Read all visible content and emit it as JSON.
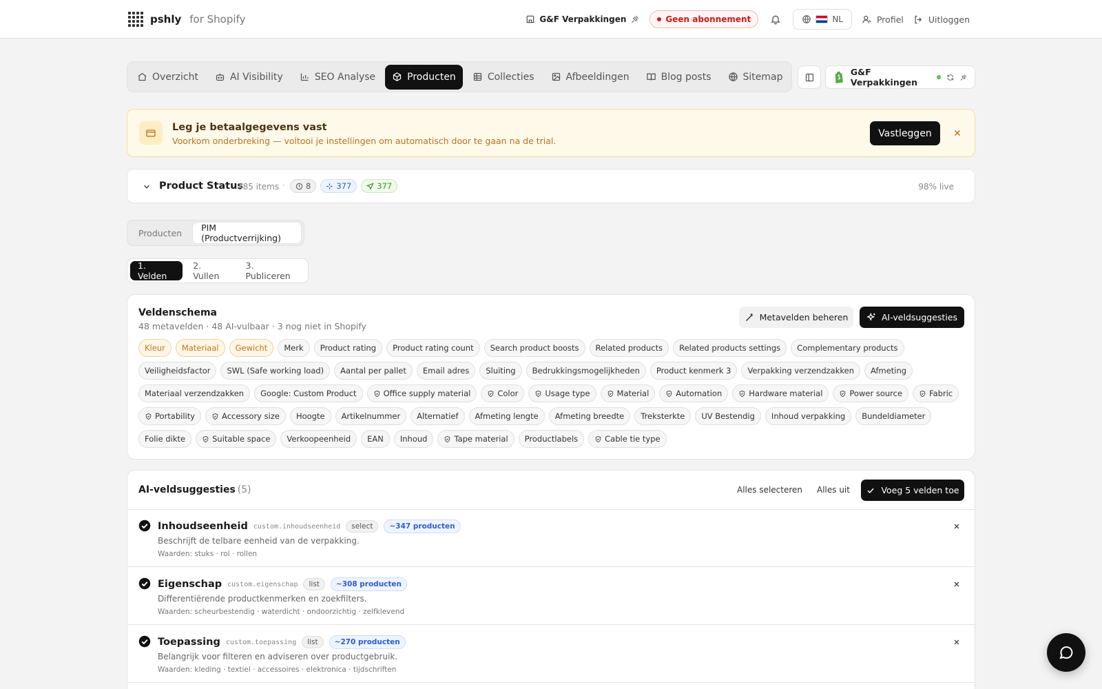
{
  "header": {
    "brand": "pshly",
    "brand_sub": "for Shopify",
    "store": "G&F Verpakkingen",
    "subscription": "Geen abonnement",
    "language": "NL",
    "profile": "Profiel",
    "logout": "Uitloggen"
  },
  "nav": {
    "tabs": [
      {
        "label": "Overzicht",
        "icon": "home-icon"
      },
      {
        "label": "AI Visibility",
        "icon": "robot-icon"
      },
      {
        "label": "SEO Analyse",
        "icon": "bar-chart-icon"
      },
      {
        "label": "Producten",
        "icon": "package-icon",
        "active": true
      },
      {
        "label": "Collecties",
        "icon": "grid-icon"
      },
      {
        "label": "Afbeeldingen",
        "icon": "image-icon"
      },
      {
        "label": "Blog posts",
        "icon": "book-icon"
      },
      {
        "label": "Sitemap",
        "icon": "globe-icon"
      }
    ],
    "store_name": "G&F Verpakkingen"
  },
  "banner": {
    "title": "Leg je betaalgegevens vast",
    "subtitle": "Voorkom onderbreking — voltooi je instellingen om automatisch door te gaan na de trial.",
    "button": "Vastleggen"
  },
  "status": {
    "title": "Product Status",
    "items": "385 items",
    "separator": "·",
    "badge_pending": "8",
    "badge_ai": "377",
    "badge_published": "377",
    "live": "98% live"
  },
  "segment": {
    "options": [
      "Producten",
      "PIM (Productverrijking)"
    ]
  },
  "steps": [
    "1. Velden",
    "2. Vullen",
    "3. Publiceren"
  ],
  "schema": {
    "title": "Veldenschema",
    "subtitle": "48 metavelden · 48 AI-vulbaar · 3 nog niet in Shopify",
    "manage_button": "Metavelden beheren",
    "suggest_button": "AI-veldsuggesties",
    "chips": [
      {
        "label": "Kleur",
        "warn": true
      },
      {
        "label": "Materiaal",
        "warn": true
      },
      {
        "label": "Gewicht",
        "warn": true
      },
      {
        "label": "Merk"
      },
      {
        "label": "Product rating"
      },
      {
        "label": "Product rating count"
      },
      {
        "label": "Search product boosts"
      },
      {
        "label": "Related products"
      },
      {
        "label": "Related products settings"
      },
      {
        "label": "Complementary products"
      },
      {
        "label": "Veiligheidsfactor"
      },
      {
        "label": "SWL (Safe working load)"
      },
      {
        "label": "Aantal per pallet"
      },
      {
        "label": "Email adres"
      },
      {
        "label": "Sluiting"
      },
      {
        "label": "Bedrukkingsmogelijkheden"
      },
      {
        "label": "Product kenmerk 3"
      },
      {
        "label": "Verpakking verzendzakken"
      },
      {
        "label": "Afmeting"
      },
      {
        "label": "Materiaal verzendzakken"
      },
      {
        "label": "Google: Custom Product"
      },
      {
        "label": "Office supply material",
        "shield": true
      },
      {
        "label": "Color",
        "shield": true
      },
      {
        "label": "Usage type",
        "shield": true
      },
      {
        "label": "Material",
        "shield": true
      },
      {
        "label": "Automation",
        "shield": true
      },
      {
        "label": "Hardware material",
        "shield": true
      },
      {
        "label": "Power source",
        "shield": true
      },
      {
        "label": "Fabric",
        "shield": true
      },
      {
        "label": "Portability",
        "shield": true
      },
      {
        "label": "Accessory size",
        "shield": true
      },
      {
        "label": "Hoogte"
      },
      {
        "label": "Artikelnummer"
      },
      {
        "label": "Alternatief"
      },
      {
        "label": "Afmeting lengte"
      },
      {
        "label": "Afmeting breedte"
      },
      {
        "label": "Treksterkte"
      },
      {
        "label": "UV Bestendig"
      },
      {
        "label": "Inhoud verpakking"
      },
      {
        "label": "Bundeldiameter"
      },
      {
        "label": "Folie dikte"
      },
      {
        "label": "Suitable space",
        "shield": true
      },
      {
        "label": "Verkoopeenheid"
      },
      {
        "label": "EAN"
      },
      {
        "label": "Inhoud"
      },
      {
        "label": "Tape material",
        "shield": true
      },
      {
        "label": "Productlabels"
      },
      {
        "label": "Cable tie type",
        "shield": true
      }
    ]
  },
  "suggestions": {
    "title": "AI-veldsuggesties",
    "count": "(5)",
    "select_all": "Alles selecteren",
    "all_off": "Alles uit",
    "add_button": "Voeg 5 velden toe",
    "rows": [
      {
        "name": "Inhoudseenheid",
        "key": "custom.inhoudseenheid",
        "type": "select",
        "products": "~347 producten",
        "desc": "Beschrijft de telbare eenheid van de verpakking.",
        "values": "Waarden: stuks · rol · rollen"
      },
      {
        "name": "Eigenschap",
        "key": "custom.eigenschap",
        "type": "list",
        "products": "~308 producten",
        "desc": "Differentiërende productkenmerken en zoekfilters.",
        "values": "Waarden: scheurbestendig · waterdicht · ondoorzichtig · zelfklevend"
      },
      {
        "name": "Toepassing",
        "key": "custom.toepassing",
        "type": "list",
        "products": "~270 producten",
        "desc": "Belangrijk voor filteren en adviseren over productgebruik.",
        "values": "Waarden: kleding · textiel · accessoires · elektronica · tijdschriften"
      }
    ]
  },
  "colors": {
    "accent": "#111111",
    "warning_bg": "#fff9ea",
    "warning_text": "#b9731f",
    "danger": "#d11a1a",
    "info": "#2e5bd6",
    "success": "#3f8f2b"
  }
}
